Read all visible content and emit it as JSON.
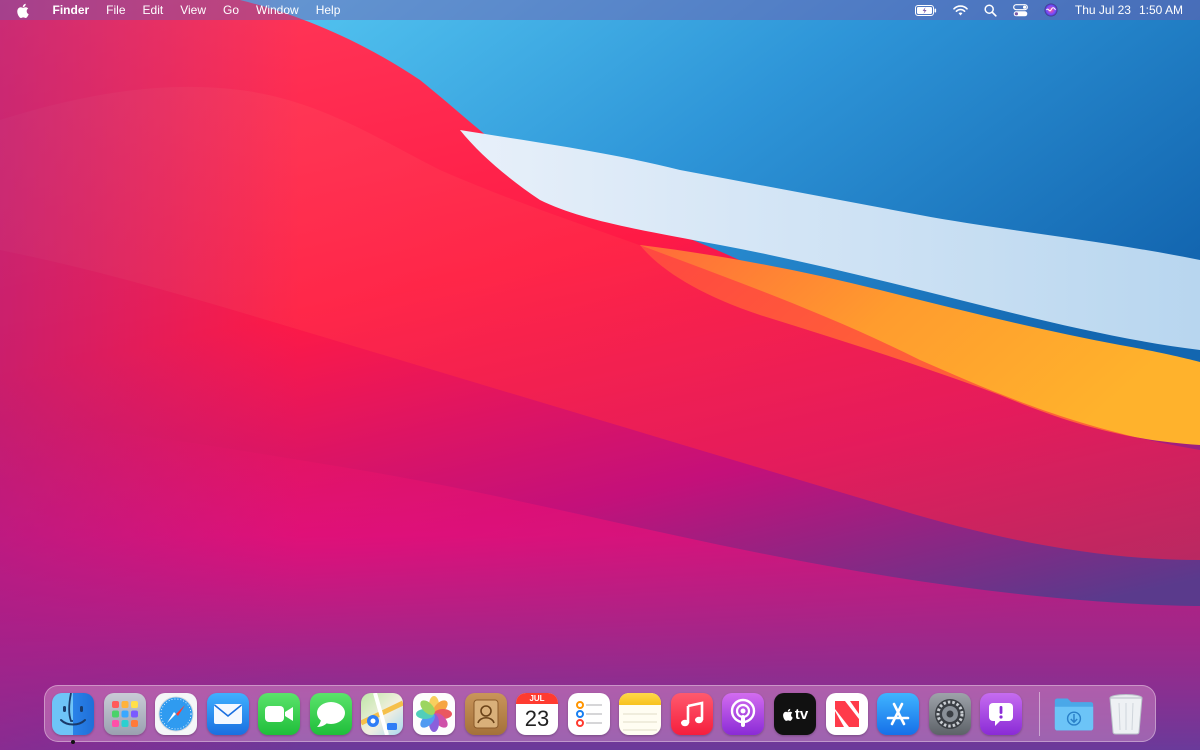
{
  "menubar": {
    "app_name": "Finder",
    "menus": [
      "File",
      "Edit",
      "View",
      "Go",
      "Window",
      "Help"
    ],
    "status_icons": [
      "battery-icon",
      "wifi-icon",
      "spotlight-icon",
      "control-center-icon",
      "siri-icon"
    ],
    "clock": {
      "date": "Thu Jul 23",
      "time": "1:50 AM"
    }
  },
  "dock": {
    "apps": [
      "Finder",
      "Launchpad",
      "Safari",
      "Mail",
      "FaceTime",
      "Messages",
      "Maps",
      "Photos",
      "Contacts",
      "Calendar",
      "Reminders",
      "Notes",
      "Music",
      "Podcasts",
      "TV",
      "News",
      "App Store",
      "System Preferences",
      "Feedback Assistant"
    ],
    "running_app": "Finder",
    "calendar": {
      "month": "JUL",
      "day": "23"
    },
    "tv_label": "tv",
    "stacks": [
      "Downloads",
      "Trash"
    ]
  },
  "colors": {
    "wallpaper_red": "#ff1e4a",
    "wallpaper_blue": "#1f8fd6",
    "wallpaper_orange": "#ffa030",
    "wallpaper_purple": "#7a2a8c"
  }
}
